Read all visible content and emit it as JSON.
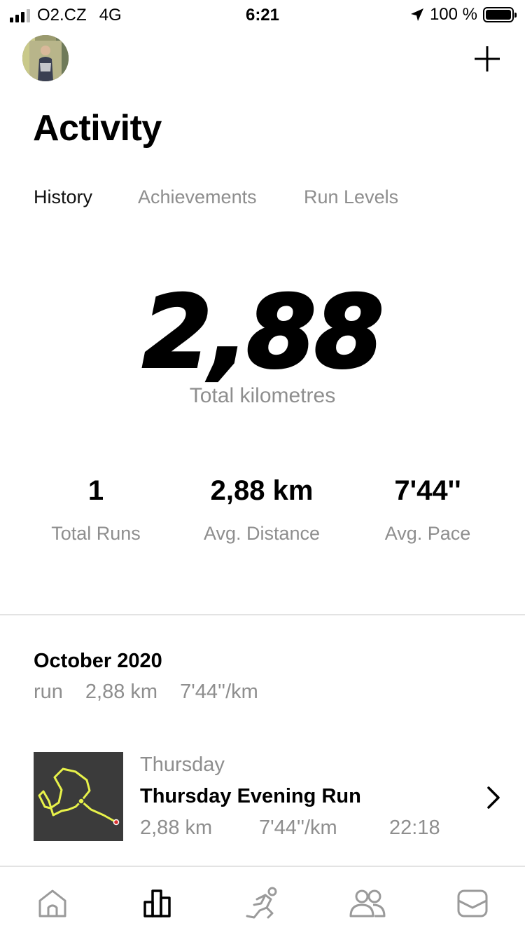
{
  "status_bar": {
    "carrier": "O2.CZ",
    "network": "4G",
    "time": "6:21",
    "battery": "100 %"
  },
  "header": {
    "title": "Activity",
    "add_icon": "plus-icon",
    "avatar_icon": "avatar"
  },
  "tabs": [
    {
      "label": "History",
      "active": true
    },
    {
      "label": "Achievements",
      "active": false
    },
    {
      "label": "Run Levels",
      "active": false
    }
  ],
  "totals": {
    "value": "2,88",
    "label": "Total kilometres"
  },
  "stats": [
    {
      "value": "1",
      "label": "Total Runs"
    },
    {
      "value": "2,88 km",
      "label": "Avg. Distance"
    },
    {
      "value": "7'44''",
      "label": "Avg. Pace"
    }
  ],
  "month": {
    "title": "October 2020",
    "runs": "run",
    "distance": "2,88 km",
    "pace": "7'44''/km"
  },
  "run": {
    "day": "Thursday",
    "title": "Thursday Evening Run",
    "distance": "2,88 km",
    "pace": "7'44''/km",
    "time": "22:18",
    "route_color": "#e8f24a"
  },
  "bottom_nav": [
    {
      "icon": "home-icon",
      "active": false
    },
    {
      "icon": "activity-chart-icon",
      "active": true
    },
    {
      "icon": "run-icon",
      "active": false
    },
    {
      "icon": "club-icon",
      "active": false
    },
    {
      "icon": "inbox-icon",
      "active": false
    }
  ],
  "colors": {
    "text_primary": "#000000",
    "text_secondary": "#8e8e8e",
    "divider": "#e3e3e3",
    "map_bg": "#3b3b3b",
    "nav_inactive": "#9a9a9a"
  }
}
